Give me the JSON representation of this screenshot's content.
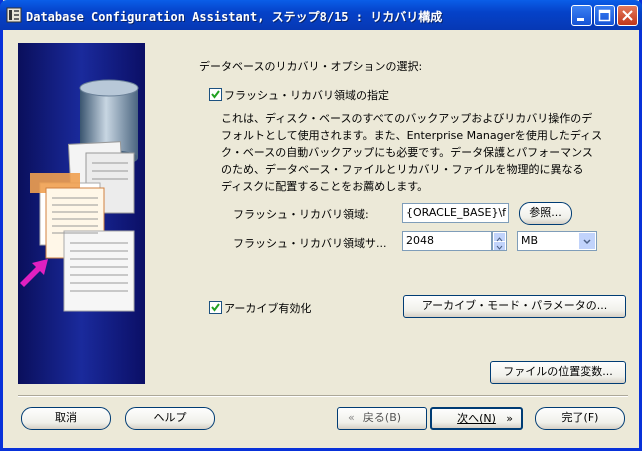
{
  "window": {
    "title": "Database Configuration Assistant, ステップ8/15 : リカバリ構成"
  },
  "heading": "データベースのリカバリ・オプションの選択:",
  "flash_recovery": {
    "checkbox_label": "フラッシュ・リカバリ領域の指定",
    "checked": true,
    "description_lines": [
      "これは、ディスク・ベースのすべてのバックアップおよびリカバリ操作のデ",
      "フォルトとして使用されます。また、Enterprise Managerを使用したディス",
      "ク・ベースの自動バックアップにも必要です。データ保護とパフォーマンス",
      "のため、データベース・ファイルとリカバリ・ファイルを物理的に異なる",
      "ディスクに配置することをお薦めします。"
    ],
    "area_label": "フラッシュ・リカバリ領域:",
    "area_value": "{ORACLE_BASE}\\f",
    "browse_button": "参照...",
    "size_label": "フラッシュ・リカバリ領域サ...",
    "size_value": "2048",
    "size_unit": "MB"
  },
  "archive": {
    "checkbox_label": "アーカイブ有効化",
    "checked": true,
    "params_button": "アーカイブ・モード・パラメータの..."
  },
  "file_location_button": "ファイルの位置変数...",
  "footer": {
    "cancel": "取消",
    "help": "ヘルプ",
    "back": "戻る(B)",
    "next": "次へ(N)",
    "finish": "完了(F)"
  },
  "colors": {
    "titlebar": "#0542c9",
    "side_panel": "#1a2a9c",
    "arrow": "#e020c0"
  }
}
